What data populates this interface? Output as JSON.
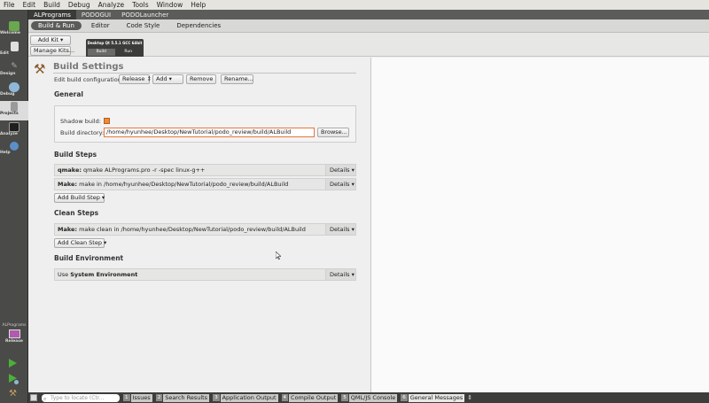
{
  "menu": [
    "File",
    "Edit",
    "Build",
    "Debug",
    "Analyze",
    "Tools",
    "Window",
    "Help"
  ],
  "project_tabs": [
    {
      "label": "ALPrograms",
      "active": true
    },
    {
      "label": "PODOGUI",
      "active": false
    },
    {
      "label": "PODOLauncher",
      "active": false
    }
  ],
  "modes": [
    {
      "label": "Welcome",
      "icon": "welcome-icon",
      "color": "#6aa84f"
    },
    {
      "label": "Edit",
      "icon": "edit-icon",
      "color": "#e0e0e0"
    },
    {
      "label": "Design",
      "icon": "design-icon",
      "color": "#9e9e9e"
    },
    {
      "label": "Debug",
      "icon": "debug-icon",
      "color": "#8fb8d8"
    },
    {
      "label": "Projects",
      "icon": "projects-icon",
      "color": "#bcbcbc"
    },
    {
      "label": "Analyze",
      "icon": "analyze-icon",
      "color": "#2d2d2d"
    },
    {
      "label": "Help",
      "icon": "help-icon",
      "color": "#5b8fc8"
    }
  ],
  "target": {
    "label": "ALPrograms",
    "mode": "Release"
  },
  "subtabs": [
    {
      "label": "Build & Run",
      "active": true
    },
    {
      "label": "Editor",
      "active": false
    },
    {
      "label": "Code Style",
      "active": false
    },
    {
      "label": "Dependencies",
      "active": false
    }
  ],
  "kits": {
    "add_kit": "Add Kit",
    "manage_kits": "Manage Kits...",
    "kit_name": "Desktop Qt 5.5.1 GCC 64bit",
    "build_label": "Build",
    "run_label": "Run"
  },
  "build_settings": {
    "title": "Build Settings",
    "config_label": "Edit build configuration:",
    "config_value": "Release",
    "add_label": "Add",
    "remove_label": "Remove",
    "rename_label": "Rename..."
  },
  "general": {
    "heading": "General",
    "shadow_label": "Shadow build:",
    "shadow_checked": true,
    "dir_label": "Build directory:",
    "dir_value": "/home/hyunhee/Desktop/NewTutorial/podo_review/build/ALBuild",
    "browse_label": "Browse..."
  },
  "build_steps": {
    "heading": "Build Steps",
    "steps": [
      {
        "name": "qmake:",
        "detail": "qmake ALPrograms.pro -r -spec linux-g++"
      },
      {
        "name": "Make:",
        "detail": "make in /home/hyunhee/Desktop/NewTutorial/podo_review/build/ALBuild"
      }
    ],
    "add_label": "Add Build Step"
  },
  "clean_steps": {
    "heading": "Clean Steps",
    "steps": [
      {
        "name": "Make:",
        "detail": "make clean in /home/hyunhee/Desktop/NewTutorial/podo_review/build/ALBuild"
      }
    ],
    "add_label": "Add Clean Step"
  },
  "environment": {
    "heading": "Build Environment",
    "prefix": "Use",
    "value": "System Environment"
  },
  "details_label": "Details",
  "output_bar": {
    "locator_placeholder": "Type to locate (Ctr...",
    "panes": [
      {
        "num": "1",
        "label": "Issues"
      },
      {
        "num": "2",
        "label": "Search Results"
      },
      {
        "num": "3",
        "label": "Application Output"
      },
      {
        "num": "4",
        "label": "Compile Output"
      },
      {
        "num": "5",
        "label": "QML/JS Console"
      },
      {
        "num": "6",
        "label": "General Messages"
      }
    ]
  }
}
